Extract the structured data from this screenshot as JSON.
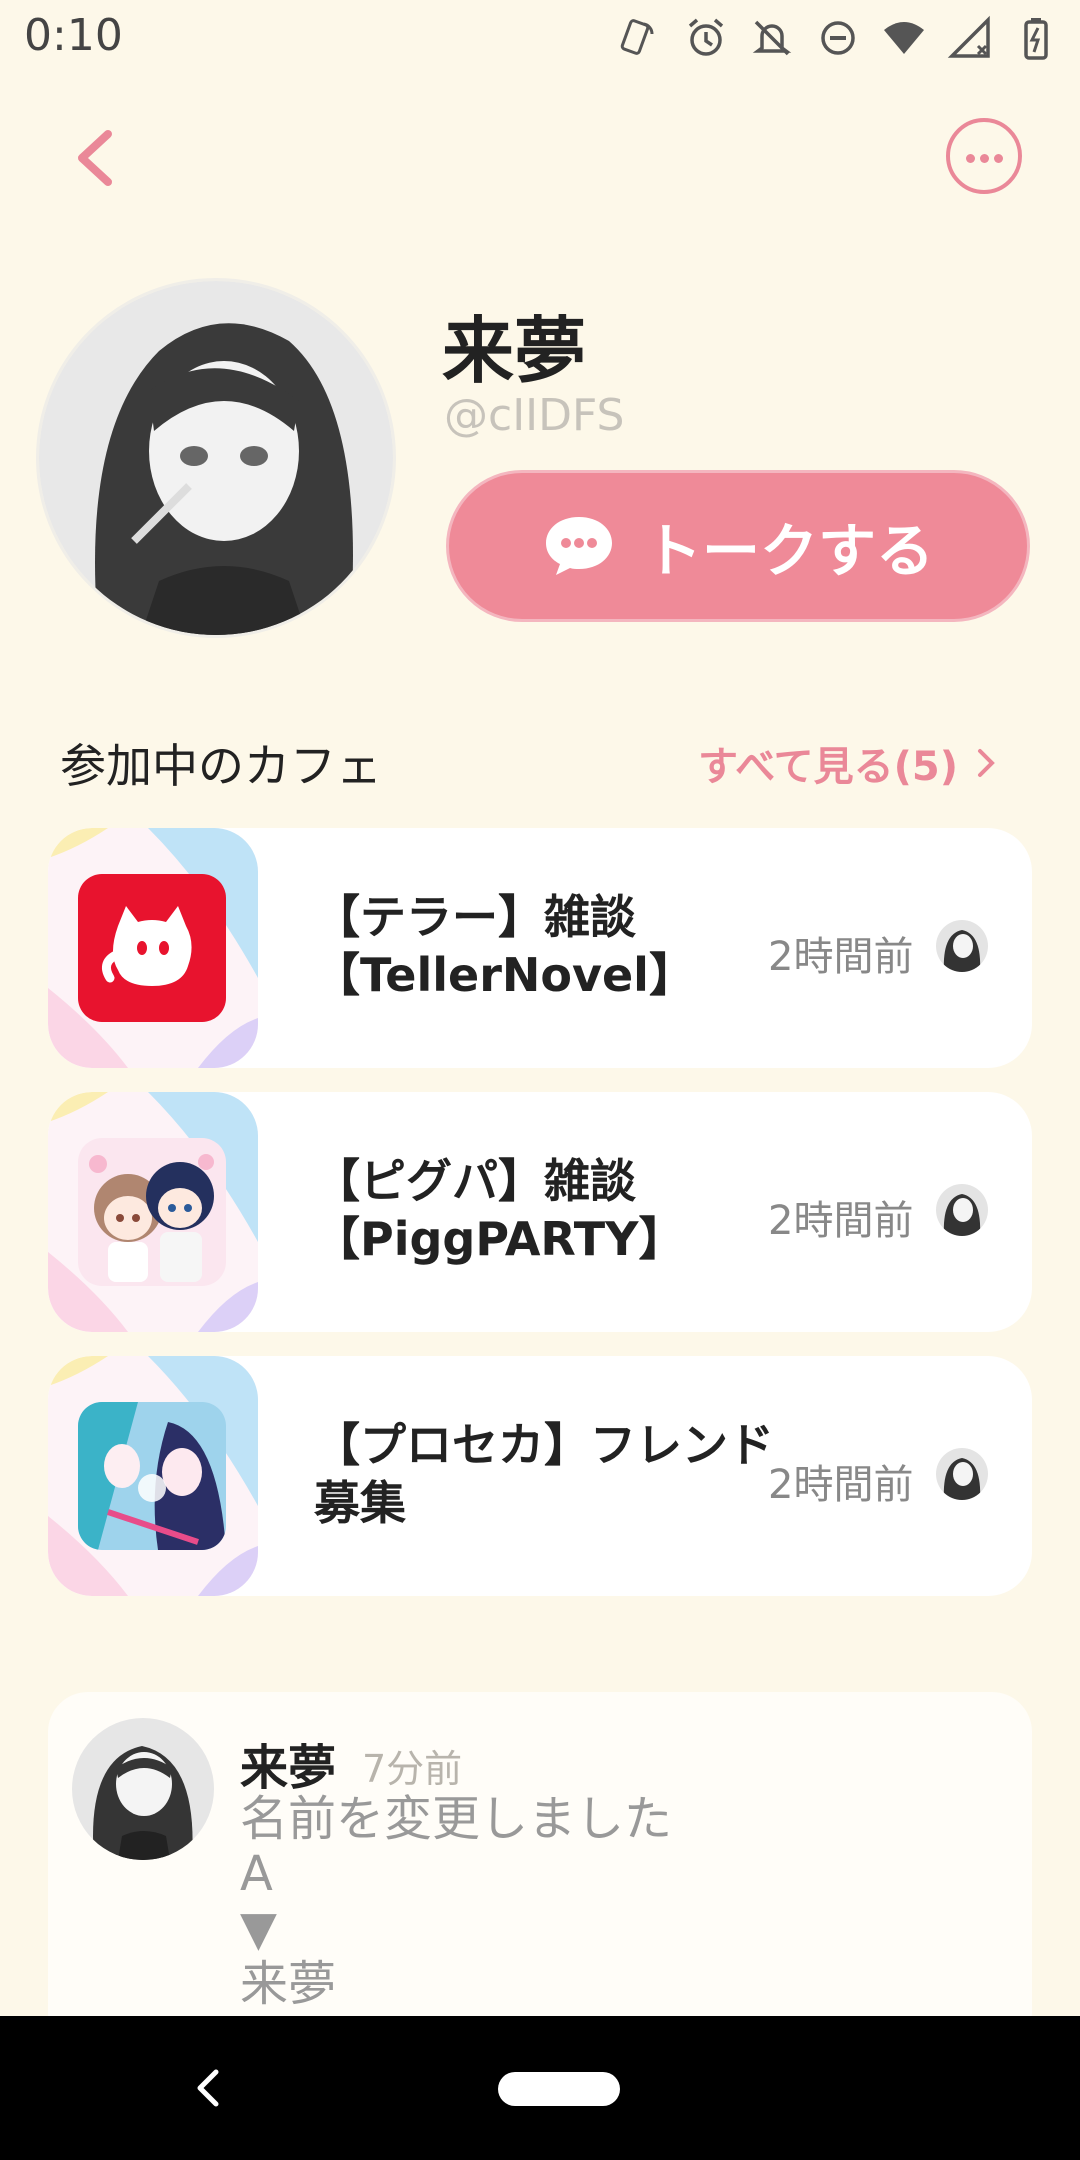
{
  "status_bar": {
    "time": "0:10",
    "icons": [
      "nfc-icon",
      "alarm-icon",
      "bell-off-icon",
      "dnd-icon",
      "wifi-icon",
      "signal-icon",
      "battery-icon"
    ]
  },
  "header": {
    "back_icon": "chevron-left-icon",
    "more_icon": "more-horizontal-icon"
  },
  "profile": {
    "name": "来夢",
    "handle": "@cIIDFS",
    "talk_button": "トークする"
  },
  "section": {
    "title": "参加中のカフェ",
    "see_all": "すべて見る(5)"
  },
  "cafes": [
    {
      "name": "【テラー】雑談【TellerNovel】",
      "time": "2時間前",
      "icon": "teller-novel-cat-icon"
    },
    {
      "name": "【ピグパ】雑談【PiggPARTY】",
      "time": "2時間前",
      "icon": "pigg-party-avatars"
    },
    {
      "name": "【プロセカ】フレンド募集",
      "time": "2時間前",
      "icon": "project-sekai-art"
    }
  ],
  "post": {
    "author": "来夢",
    "time": "7分前",
    "body": "名前を変更しました\nA\n▼\n来夢"
  },
  "colors": {
    "background": "#fdf8e9",
    "accent": "#ea8898",
    "button": "#ef8a98"
  }
}
